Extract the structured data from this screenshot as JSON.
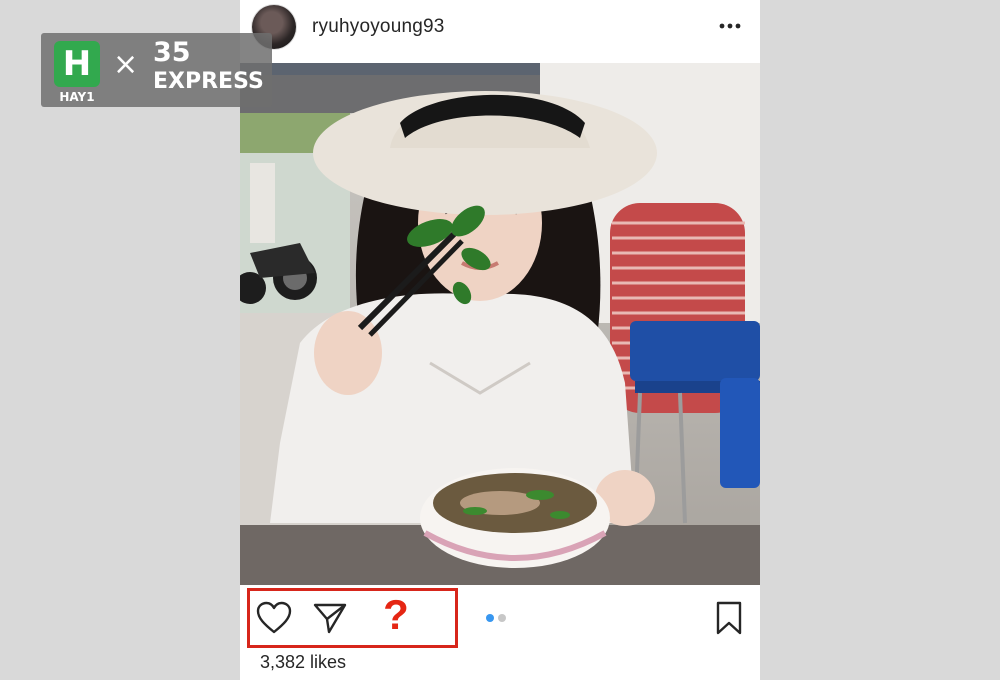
{
  "post": {
    "username": "ryuhyoyoung93",
    "likes_text": "3,382 likes",
    "carousel": {
      "count": 2,
      "active_index": 0
    }
  },
  "watermark": {
    "badge_letter": "H",
    "badge_label": "HAY1",
    "separator": "×",
    "partner_number": "35",
    "partner_word": "EXPRESS"
  },
  "annotation": {
    "question_mark": "?",
    "highlight_color": "#d7261b"
  },
  "icons": {
    "more": "more-horizontal-icon",
    "like": "heart-outline-icon",
    "share": "send-paper-plane-icon",
    "save": "bookmark-outline-icon"
  },
  "colors": {
    "background": "#d9d9d9",
    "carousel_active": "#3897f0",
    "carousel_inactive": "#c7c7c7",
    "question_mark": "#e52613",
    "watermark_green": "#32a94e"
  }
}
